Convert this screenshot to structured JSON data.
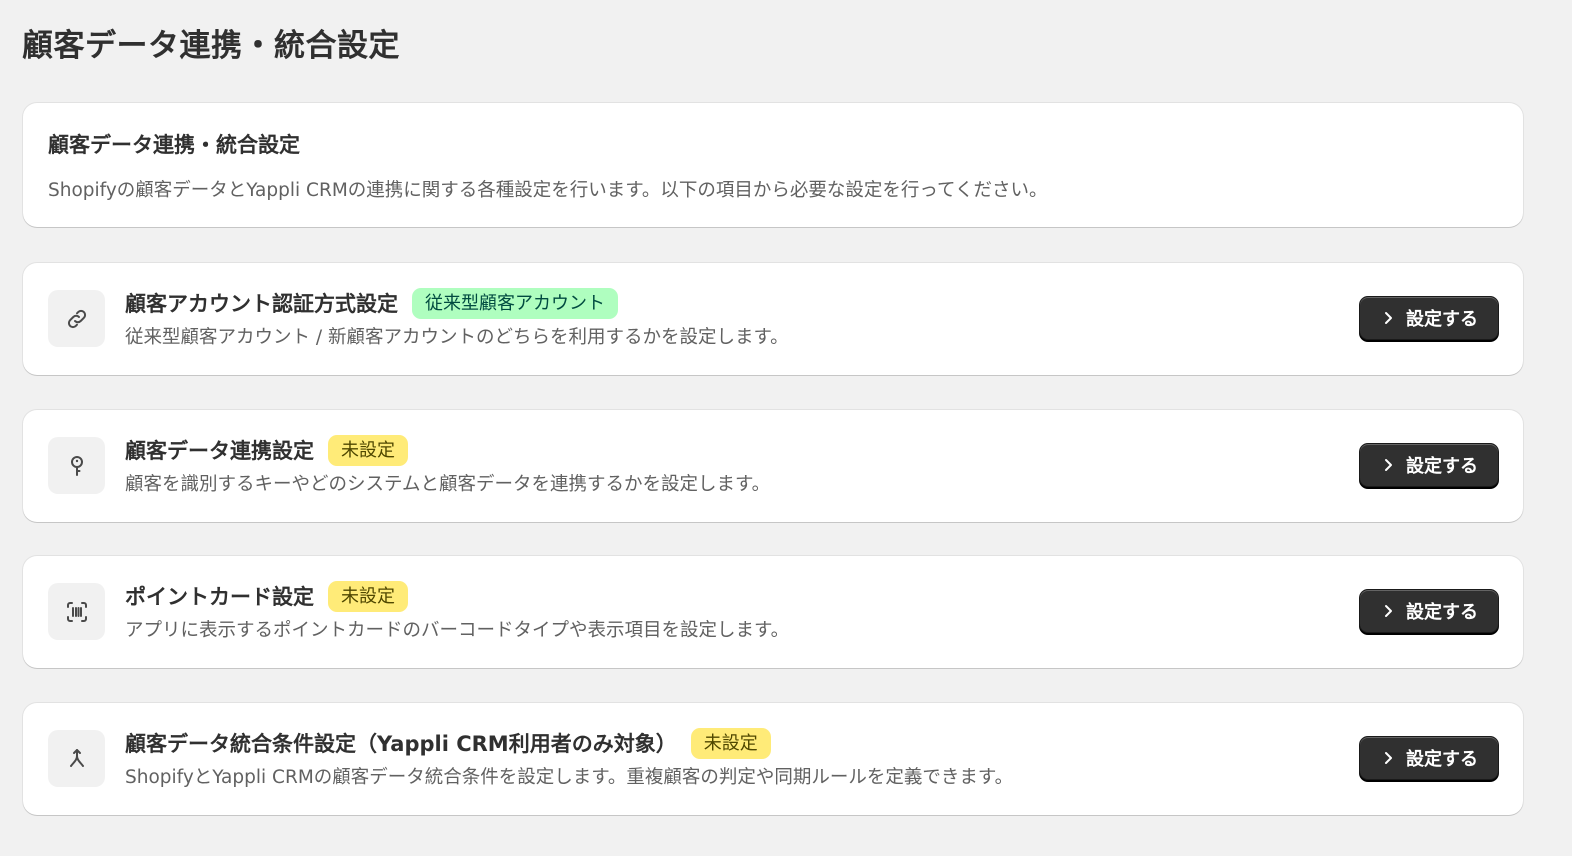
{
  "page": {
    "title": "顧客データ連携・統合設定"
  },
  "intro": {
    "title": "顧客データ連携・統合設定",
    "description": "Shopifyの顧客データとYappli CRMの連携に関する各種設定を行います。以下の項目から必要な設定を行ってください。"
  },
  "settings": [
    {
      "icon": "link-icon",
      "title": "顧客アカウント認証方式設定",
      "badge": "従来型顧客アカウント",
      "badge_status": "success",
      "description": "従来型顧客アカウント / 新顧客アカウントのどちらを利用するかを設定します。",
      "button_label": "設定する"
    },
    {
      "icon": "key-icon",
      "title": "顧客データ連携設定",
      "badge": "未設定",
      "badge_status": "warning",
      "description": "顧客を識別するキーやどのシステムと顧客データを連携するかを設定します。",
      "button_label": "設定する"
    },
    {
      "icon": "barcode-scan-icon",
      "title": "ポイントカード設定",
      "badge": "未設定",
      "badge_status": "warning",
      "description": "アプリに表示するポイントカードのバーコードタイプや表示項目を設定します。",
      "button_label": "設定する"
    },
    {
      "icon": "merge-icon",
      "title": "顧客データ統合条件設定（Yappli CRM利用者のみ対象）",
      "badge": "未設定",
      "badge_status": "warning",
      "description": "ShopifyとYappli CRMの顧客データ統合条件を設定します。重複顧客の判定や同期ルールを定義できます。",
      "button_label": "設定する"
    }
  ],
  "colors": {
    "background": "#f1f1f1",
    "card": "#ffffff",
    "button": "#303030",
    "badge_success_bg": "#affebf",
    "badge_success_text": "#014b40",
    "badge_warning_bg": "#ffeb78",
    "badge_warning_text": "#4f4700"
  }
}
